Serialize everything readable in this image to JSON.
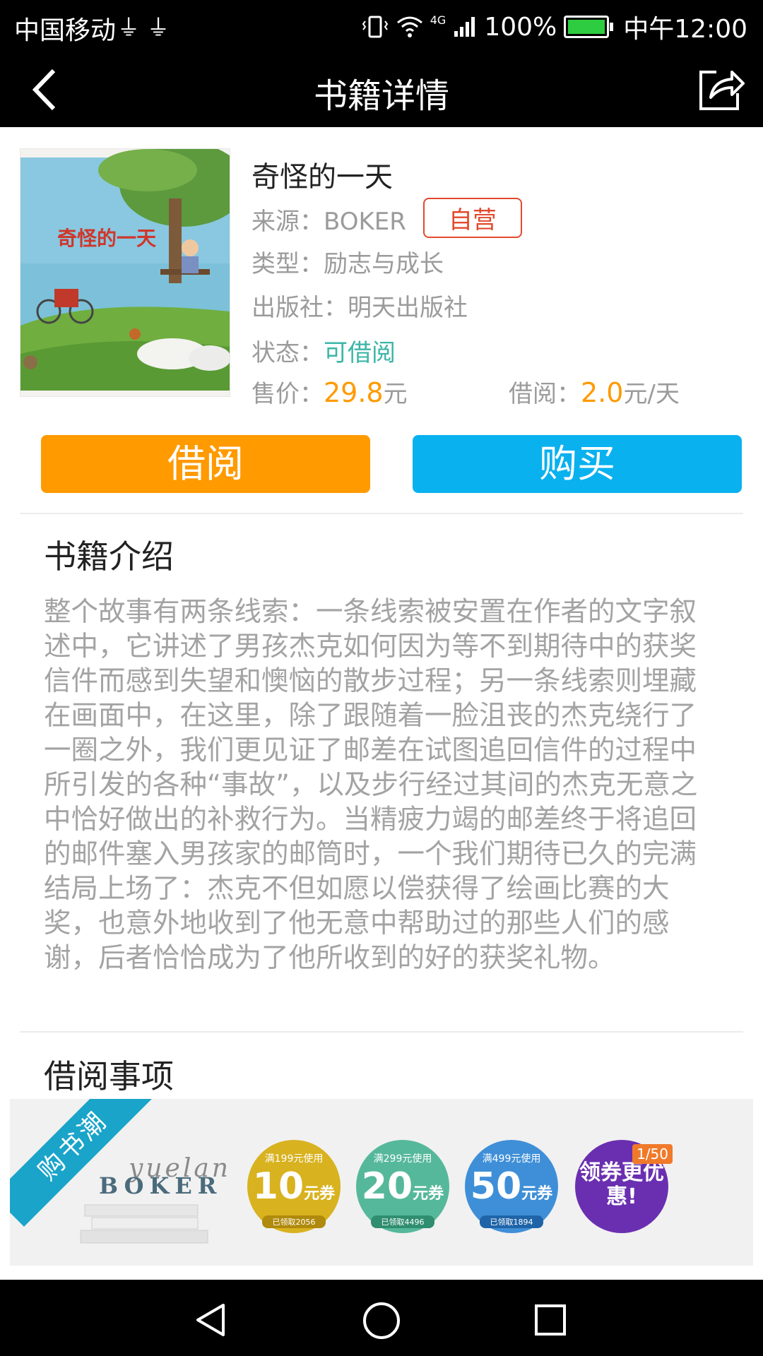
{
  "status_bar": {
    "carrier": "中国移动",
    "usb_icons": [
      "usb-icon",
      "usb-icon"
    ],
    "network_type": "4G",
    "battery_percent": "100%",
    "time": "中午12:00"
  },
  "header": {
    "title": "书籍详情",
    "back_icon": "chevron-left-icon",
    "share_icon": "share-icon"
  },
  "book": {
    "cover_title": "奇怪的一天",
    "title": "奇怪的一天",
    "source_label": "来源：",
    "source_value": "BOKER",
    "self_operated_tag": "自营",
    "type_label": "类型：",
    "type_value": "励志与成长",
    "publisher_label": "出版社：",
    "publisher_value": "明天出版社",
    "status_label": "状态：",
    "status_value": "可借阅",
    "price_label": "售价：",
    "price_value": "29.8",
    "price_unit": "元",
    "rent_label": "借阅：",
    "rent_value": "2.0",
    "rent_unit": "元/天"
  },
  "actions": {
    "borrow_label": "借阅",
    "buy_label": "购买"
  },
  "intro": {
    "heading": "书籍介绍",
    "text": "整个故事有两条线索：一条线索被安置在作者的文字叙述中，它讲述了男孩杰克如何因为等不到期待中的获奖信件而感到失望和懊恼的散步过程；另一条线索则埋藏在画面中，在这里，除了跟随着一脸沮丧的杰克绕行了一圈之外，我们更见证了邮差在试图追回信件的过程中所引发的各种“事故”，以及步行经过其间的杰克无意之中恰好做出的补救行为。当精疲力竭的邮差终于将追回的邮件塞入男孩家的邮筒时，一个我们期待已久的完满结局上场了：杰克不但如愿以偿获得了绘画比赛的大奖，也意外地收到了他无意中帮助过的那些人们的感谢，后者恰恰成为了他所收到的好的获奖礼物。"
  },
  "borrow_notes": {
    "heading": "借阅事项"
  },
  "banner": {
    "ribbon": "购书潮",
    "brand_sub": "yuelan",
    "brand": "BOKER",
    "coupons": [
      {
        "cond": "满199元使用",
        "amount": "10",
        "unit": "元券",
        "claimed": "已领取2056",
        "color": "#d8b21f"
      },
      {
        "cond": "满299元使用",
        "amount": "20",
        "unit": "元券",
        "claimed": "已领取4496",
        "color": "#56b89a"
      },
      {
        "cond": "满499元使用",
        "amount": "50",
        "unit": "元券",
        "claimed": "已领取1894",
        "color": "#3f8fd8"
      }
    ],
    "promo_text": "领券更优惠!",
    "promo_badge": "1/50"
  },
  "nav": {
    "back_icon": "triangle-back-icon",
    "home_icon": "circle-home-icon",
    "recents_icon": "square-recents-icon"
  }
}
